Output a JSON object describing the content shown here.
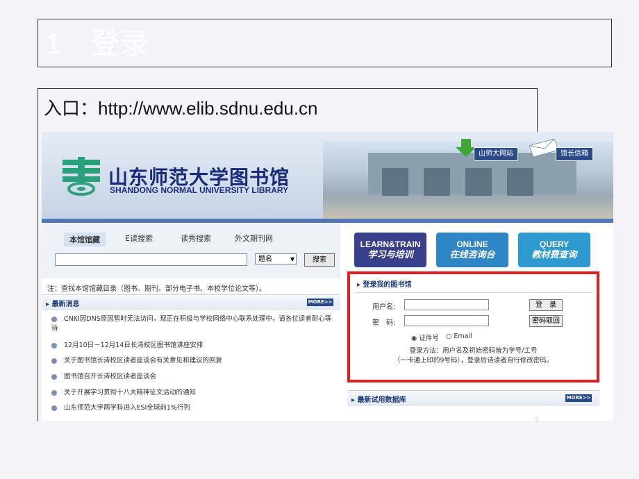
{
  "slide": {
    "title": "1　登录",
    "url_label": "入口：http://www.elib.sdnu.edu.cn"
  },
  "library": {
    "name_cn": "山东师范大学图书馆",
    "name_en": "SHANDONG NORMAL UNIVERSITY LIBRARY",
    "link_main": "山师大网站",
    "link_mail": "馆长信箱"
  },
  "search": {
    "tabs": [
      "本馆馆藏",
      "E读搜索",
      "读秀搜索",
      "外文期刊网"
    ],
    "field_select": "题名",
    "button": "搜索",
    "note": "注：查找本馆馆藏目录（图书、期刊、部分电子书、本校学位论文等）。"
  },
  "news": {
    "title": "最新消息",
    "more": "MORE>>",
    "items": [
      "CNKI因DNS原因暂时无法访问，现正在积极与学校网络中心联系处理中，请各位读者耐心等待",
      "12月10日－12月14日长清校区图书馆讲座安排",
      "关于图书馆长清校区读者座谈会有关意见和建议的回复",
      "图书馆召开长清校区读者座谈会",
      "关于开展学习贯彻十八大精神征文活动的通知",
      "山东师范大学两学科进入ESI全球前1%行列"
    ]
  },
  "quick": {
    "learn_en": "LEARN&TRAIN",
    "learn_cn": "学习与培训",
    "online_en": "ONLINE",
    "online_cn": "在线咨询台",
    "query_en": "QUERY",
    "query_cn": "教材费查询"
  },
  "login": {
    "title": "登录我的图书馆",
    "user_label": "用户名:",
    "pass_label": "密　码:",
    "login_button": "登　录",
    "recover_button": "密码取回",
    "radio_id": "证件号",
    "radio_email": "Email",
    "hint1": "登录方法：用户名及初始密码皆为学号/工号",
    "hint2": "（一卡通上印的9号码），登录后请读者自行修改密码。"
  },
  "trial": {
    "title": "最新试用数据库",
    "more": "MORE>>"
  },
  "colors": {
    "highlight": "#e02020",
    "brand_blue": "#1a2a7a",
    "learn_btn": "#3a3f8c",
    "online_btn": "#2f86c6",
    "query_btn": "#2f9ad0"
  }
}
